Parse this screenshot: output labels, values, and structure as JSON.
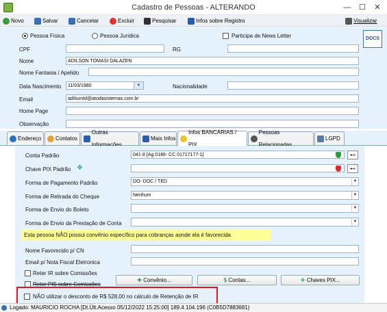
{
  "window": {
    "title": "Cadastro de Pessoas - ALTERANDO",
    "min": "—",
    "max": "☐",
    "close": "✕"
  },
  "toolbar": {
    "novo": "Novo",
    "salvar": "Salvar",
    "cancelar": "Cancelar",
    "excluir": "Excluir",
    "pesquisar": "Pesquisar",
    "infos": "Infos sobre Registro",
    "visualizar": "Visualizar"
  },
  "form": {
    "pessoa_fisica": "Pessoa Física",
    "pessoa_juridica": "Pessoa Jurídica",
    "news_letter": "Participa de News Letter",
    "cpf_label": "CPF",
    "cpf_value": "",
    "rg_label": "RG",
    "rg_value": "",
    "nome_label": "Nome",
    "nome_value": "ADILSON TOMASI DALAZEN",
    "fantasia_label": "Nome Fantasia / Apelido",
    "fantasia_value": "",
    "nascimento_label": "Data Nascimento",
    "nascimento_value": "11/03/1980",
    "nacionalidade_label": "Nacionalidade",
    "nacionalidade_value": "",
    "email_label": "Email",
    "email_value": "adilsontd@atodasistemas.com.br",
    "homepage_label": "Home Page",
    "homepage_value": "",
    "obs_label": "Observação",
    "obs_value": ""
  },
  "tabs": [
    "Endereço",
    "Contatos",
    "Outras Informações",
    "Mais Infos",
    "Infos BANCÁRIAS / PIX",
    "Pessoas Relacionadas",
    "LGPD"
  ],
  "bank": {
    "conta_label": "Conta Padrão",
    "conta_value": "041-8 [Ag 0186- CC 01717177-1]",
    "pix_label": "Chave PIX Padrão",
    "pix_value": "",
    "forma_pag_label": "Forma de Pagamento Padrão",
    "forma_pag_value": "DO- DOC / TED",
    "retirada_label": "Forma de Retirada do Cheque",
    "retirada_value": "Nenhum",
    "boleto_label": "Forma de Envio do Boleto",
    "boleto_value": "",
    "prestacao_label": "Forma de Envio da Prestação de Conta",
    "prestacao_value": "",
    "convenio_notice": "Esta pessoa NÃO possui convênio específico para cobranças aonde ela é favorecida",
    "favorecido_label": "Nome Favorecido p/ CN",
    "favorecido_value": "",
    "email_nf_label": "Email p/ Nota Fiscal Eletronica",
    "email_nf_value": "",
    "reter_ir": "Reter IR sobre Comissões",
    "reter_pis": "Reter PIS sobre Comissões",
    "convenio_btn": "Convênio...",
    "contas_btn": "Contas...",
    "chaves_btn": "Chaves PIX...",
    "nao_utilizar": "NÃO utilizar o desconto de R$ 528,00 no cálculo de Retenção de IR"
  },
  "status": {
    "text": "Logado: MAURICIO ROCHA   [Dt.Últ.Acesso 05/12/2022 15:25:00]   189.4.104.196 (C0B5D7883681)"
  },
  "colors": {
    "panel": "#e6f2fb",
    "notice_bg": "#ffff99",
    "highlight_border": "#e0141e"
  }
}
